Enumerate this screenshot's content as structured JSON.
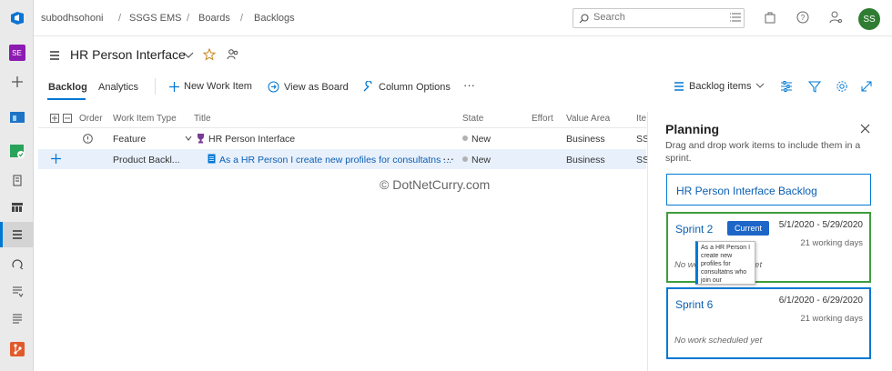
{
  "breadcrumb": {
    "org": "subodhsohoni",
    "project": "SSGS EMS",
    "section": "Boards",
    "page": "Backlogs"
  },
  "search": {
    "placeholder": "Search"
  },
  "user": {
    "initials": "SS"
  },
  "project_badge": "SE",
  "team": {
    "title": "HR Person Interface"
  },
  "tabs": [
    "Backlog",
    "Analytics"
  ],
  "toolbar": {
    "new_work_item": "New Work Item",
    "view_as_board": "View as Board",
    "column_options": "Column Options",
    "more": "···",
    "backlog_level": "Backlog items"
  },
  "grid": {
    "headers": {
      "order": "Order",
      "type": "Work Item Type",
      "title": "Title",
      "state": "State",
      "effort": "Effort",
      "value_area": "Value Area",
      "iteration": "Ite"
    },
    "rows": [
      {
        "type": "Feature",
        "title": "HR Person Interface",
        "state": "New",
        "value_area": "Business",
        "iteration": "SS"
      },
      {
        "type": "Product Backl...",
        "title": "As a HR Person I create new profiles for consultatns ...",
        "state": "New",
        "value_area": "Business",
        "iteration": "SS"
      }
    ]
  },
  "watermark": "© DotNetCurry.com",
  "planning": {
    "title": "Planning",
    "description": "Drag and drop work items to include them in a sprint.",
    "backlog_card": "HR Person Interface Backlog",
    "sprints": [
      {
        "name": "Sprint 2",
        "badge": "Current",
        "dates": "5/1/2020 - 5/29/2020",
        "days": "21 working days",
        "empty": "No work scheduled yet"
      },
      {
        "name": "Sprint 6",
        "dates": "6/1/2020 - 6/29/2020",
        "days": "21 working days",
        "empty": "No work scheduled yet"
      }
    ],
    "drag_preview": "As a HR Person I create new profiles for consultatns who join our"
  },
  "colors": {
    "accent": "#0078d4",
    "current_sprint": "#3d9d3d",
    "avatar": "#2e7d32"
  }
}
